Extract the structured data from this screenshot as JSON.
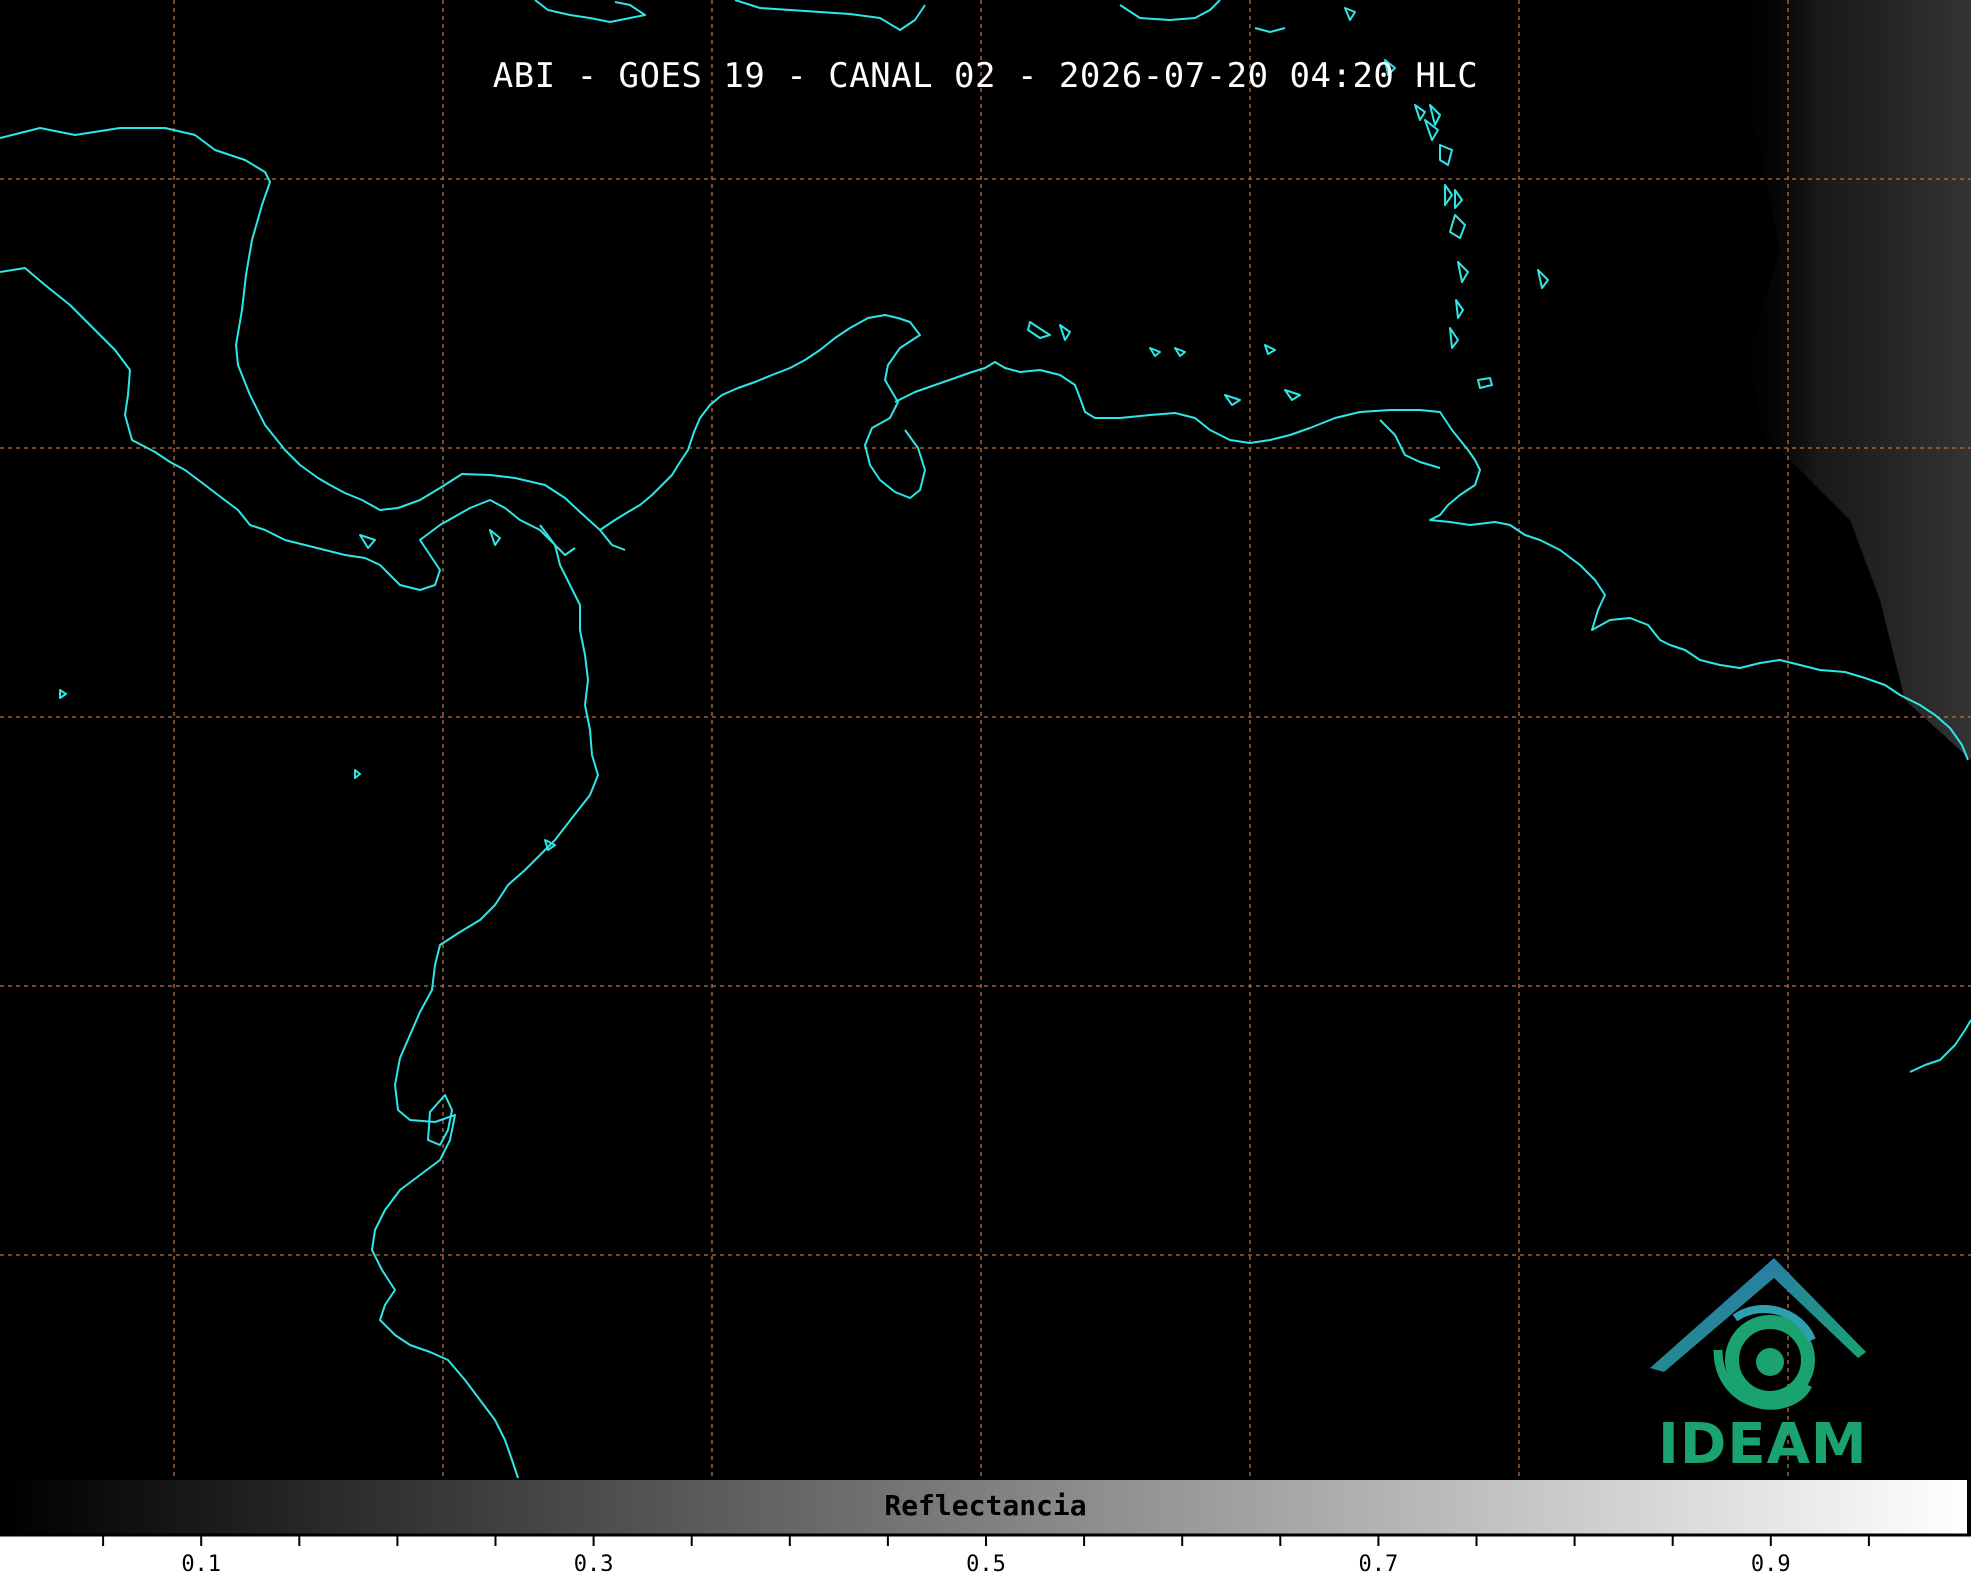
{
  "title": "ABI - GOES 19 - CANAL 02 - 2026-07-20 04:20 HLC",
  "colors": {
    "background": "#000000",
    "coastline": "#2ee6e6",
    "graticule": "#c0703a",
    "logo_blue": "#2f6fb8",
    "logo_teal": "#1aa36f"
  },
  "logo": {
    "text": "IDEAM",
    "icon": "ideam-mountain-eye-icon"
  },
  "colorbar": {
    "label": "Reflectancia",
    "range": [
      0,
      1
    ],
    "colormap": "grayscale",
    "tick_labels": [
      "0.1",
      "0.3",
      "0.5",
      "0.7",
      "0.9"
    ]
  }
}
